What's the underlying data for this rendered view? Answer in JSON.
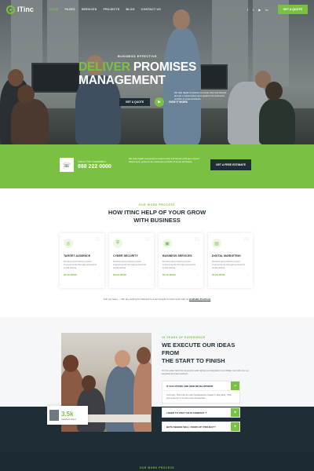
{
  "brand": {
    "name": "ITinc"
  },
  "nav": {
    "items": [
      "HOME",
      "PAGES",
      "SERVICES",
      "PROJECTS",
      "BLOG",
      "CONTACT US"
    ],
    "active_index": 0,
    "socials": [
      "f",
      "t",
      "▶",
      "in"
    ],
    "quote_button": "GET A QUOTE"
  },
  "hero": {
    "eyebrow": "BUSINESS EFFECTIVE",
    "title_line1_a": "DELIVER",
    "title_line1_b": " PROMISES",
    "title_line2": "MANAGEMENT",
    "description": "We help digital companies to ensure their self interest and get a space based upon goals for its customers portfolio of smart architects.",
    "quote_button": "GET A QUOTE",
    "how_label": "HOW IT WORK"
  },
  "band": {
    "call_label": "Call us Free Consultation",
    "phone": "888 222 0000",
    "text": "We help digital companies to ensure their self interest and get a space based upon goals for its customers portfolio of smart architects.",
    "button": "GET A FREE ESTIMATE"
  },
  "services": {
    "eyebrow": "OUR WORK PROCESS",
    "title_line1": "HOW ITINC HELP OF YOUR GROW",
    "title_line2": "WITH BUSINESS",
    "cards": [
      {
        "num": "01",
        "icon": "target-icon",
        "title": "TARGET AUDIENCE",
        "text": "Develop and produce proven improvements through personal & social testing.",
        "more": "READ MORE"
      },
      {
        "num": "02",
        "icon": "shield-icon",
        "title": "CYBER SECURITY",
        "text": "Develop and produce proven improvements through personal & social testing.",
        "more": "READ MORE"
      },
      {
        "num": "03",
        "icon": "briefcase-icon",
        "title": "BUSINESS SERVICES",
        "text": "Develop and produce proven improvements through personal & social testing.",
        "more": "READ MORE"
      },
      {
        "num": "04",
        "icon": "chart-icon",
        "title": "DIGITAL MARKETING",
        "text": "Develop and produce proven improvements through personal & social testing.",
        "more": "READ MORE"
      }
    ],
    "careers_text": "Join our team — We are looking for talented & smart people to come work with us",
    "careers_link": "Available Positions"
  },
  "about": {
    "eyebrow": "10 YEARS OF EXPERIENCE",
    "title_line1": "WE EXECUTE OUR IDEAS FROM",
    "title_line2": "THE START TO FINISH",
    "description": "On the other hand we denounce with righteous indignation and dislike men who are so beguiled and demoralized.",
    "stat_number": "3.5k",
    "stat_label": "Satisfied Client",
    "faq": [
      {
        "q": "IT SOLUTIONS AND WEB DEVELOPMENT",
        "a": "Currently, ITinc has its main headquarters based in Maryland, USA, and a branch in London and Amsterdam.",
        "open": true
      },
      {
        "q": "I NEED TO VISIT YOUR COMPANY ?",
        "open": false
      },
      {
        "q": "BOTH WHERE WILL I WORK MY PROJECT?",
        "open": false
      }
    ]
  },
  "strip": {
    "eyebrow": "OUR WORK PROCESS"
  }
}
